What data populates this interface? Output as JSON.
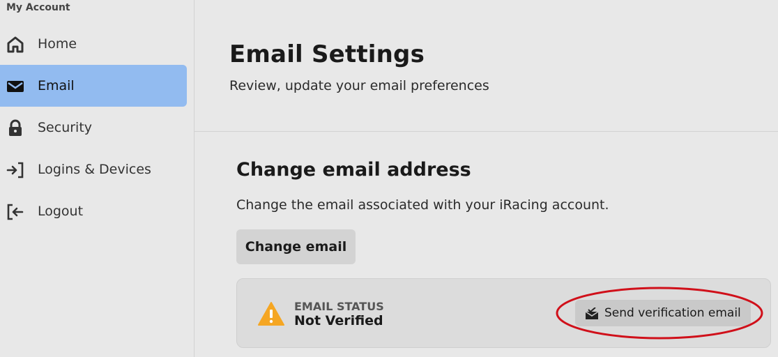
{
  "sidebar": {
    "title": "My Account",
    "items": [
      {
        "label": "Home",
        "icon": "home-icon",
        "active": false
      },
      {
        "label": "Email",
        "icon": "envelope-icon",
        "active": true
      },
      {
        "label": "Security",
        "icon": "lock-icon",
        "active": false
      },
      {
        "label": "Logins & Devices",
        "icon": "login-icon",
        "active": false
      },
      {
        "label": "Logout",
        "icon": "logout-icon",
        "active": false
      }
    ]
  },
  "header": {
    "title": "Email Settings",
    "subtitle": "Review, update your email preferences"
  },
  "section": {
    "title": "Change email address",
    "description": "Change the email associated with your iRacing account.",
    "change_button": "Change email"
  },
  "status_card": {
    "label": "EMAIL STATUS",
    "value": "Not Verified",
    "warning_icon": "warning-triangle-icon",
    "verify_button": "Send verification email",
    "verify_icon": "mail-send-icon"
  },
  "annotation": {
    "ellipse_color": "#d0101a"
  },
  "colors": {
    "background": "#e8e8e8",
    "active_nav": "#92bbf0",
    "warning": "#f5a623"
  }
}
